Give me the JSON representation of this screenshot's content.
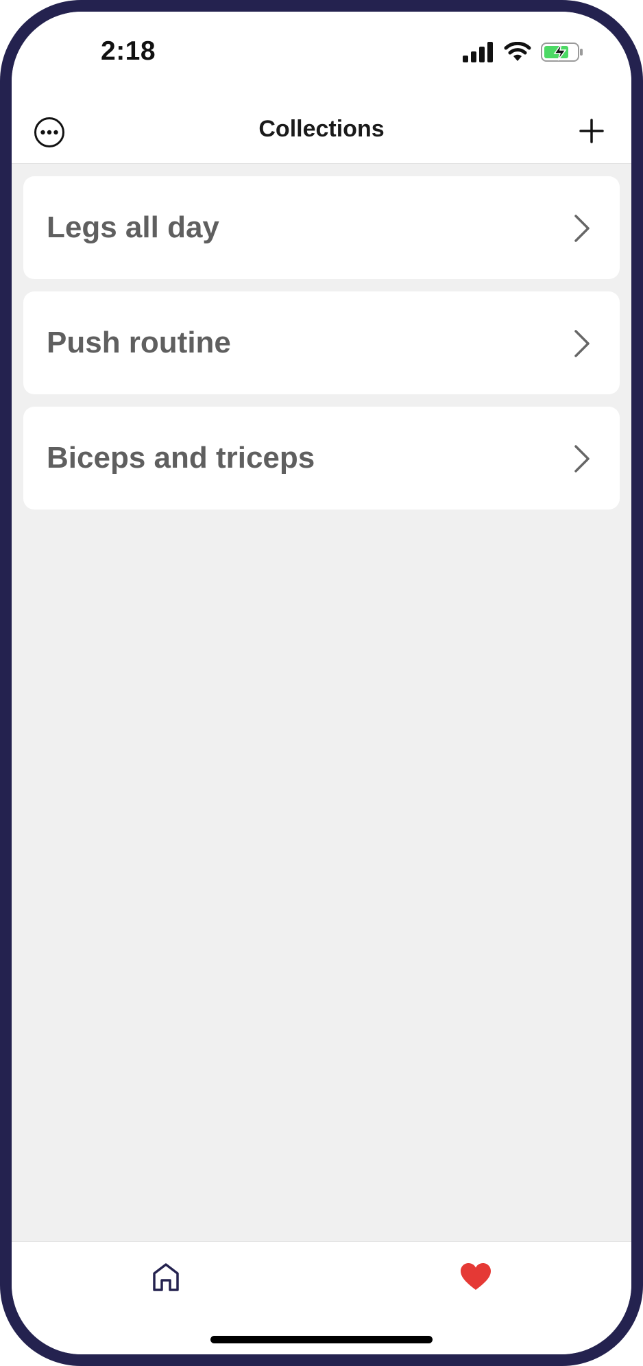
{
  "status_bar": {
    "time": "2:18",
    "icons": [
      "signal-icon",
      "wifi-icon",
      "battery-charging-icon"
    ],
    "battery_color": "#4cd964"
  },
  "nav": {
    "title": "Collections",
    "left_icon": "more-icon",
    "right_icon": "plus-icon"
  },
  "collections": [
    {
      "label": "Legs all day"
    },
    {
      "label": "Push routine"
    },
    {
      "label": "Biceps and triceps"
    }
  ],
  "tab_bar": {
    "items": [
      {
        "icon": "home-icon",
        "color": "#24224f"
      },
      {
        "icon": "heart-icon",
        "color": "#e53935"
      }
    ]
  },
  "colors": {
    "frame": "#24224f",
    "background": "#f0f0f0",
    "card": "#ffffff",
    "label": "#5f5f5f"
  }
}
